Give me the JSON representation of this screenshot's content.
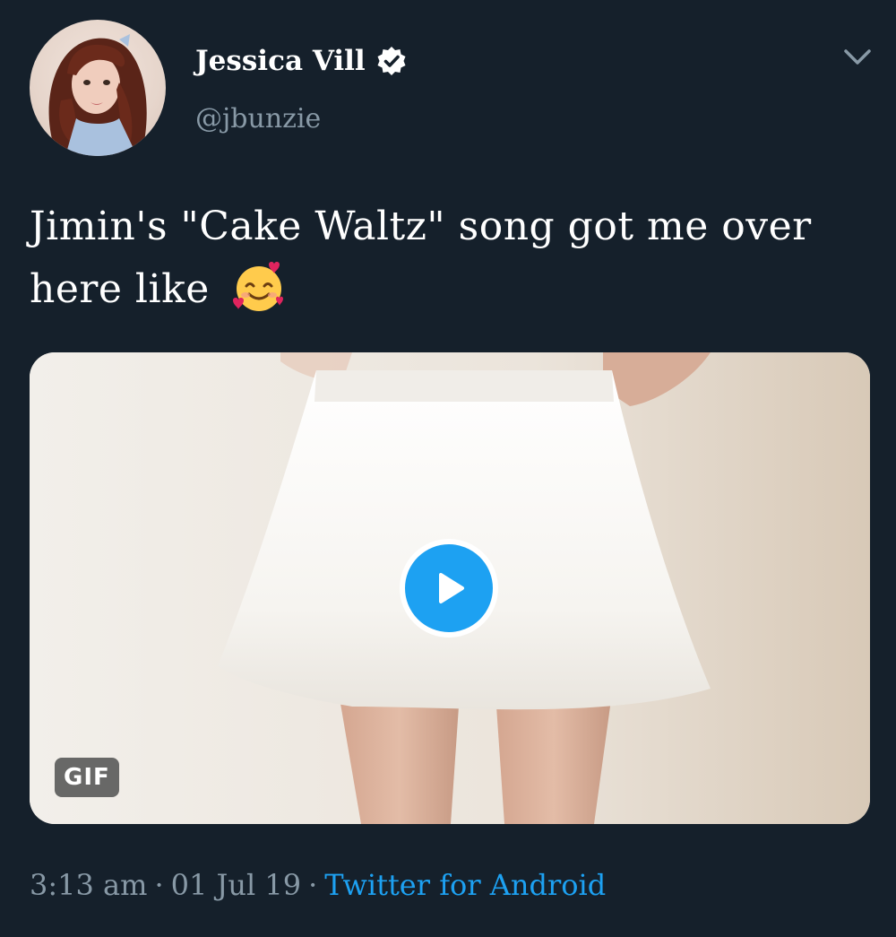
{
  "tweet": {
    "author": {
      "display_name": "Jessica Vill",
      "handle": "@jbunzie",
      "verified": true
    },
    "text_line1": "Jimin's \"Cake Waltz\" song got me over",
    "text_line2": "here like",
    "emoji": "smiling-face-with-hearts",
    "media": {
      "type": "gif",
      "badge_label": "GIF"
    },
    "meta": {
      "time": "3:13 am",
      "date": "01 Jul 19",
      "source": "Twitter for Android",
      "separator": "·"
    }
  },
  "colors": {
    "background": "#15202b",
    "text_primary": "#ffffff",
    "text_secondary": "#8899a6",
    "accent": "#1da1f2"
  }
}
